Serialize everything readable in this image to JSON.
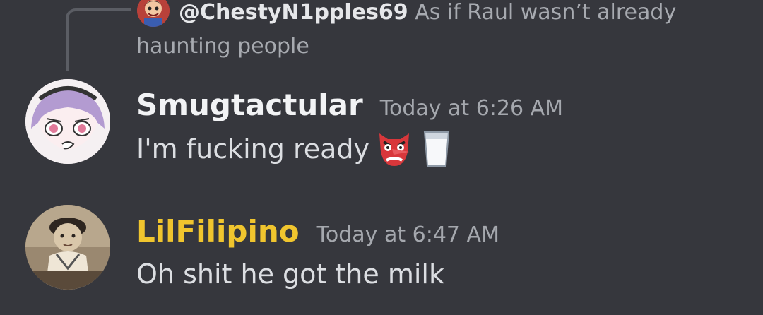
{
  "reply": {
    "username": "@ChestyN1pples69",
    "text": "As if Raul wasn’t already haunting people"
  },
  "messages": [
    {
      "username": "Smugtactular",
      "username_color": "#f2f3f5",
      "timestamp": "Today at 6:26 AM",
      "text": "I'm fucking ready",
      "emojis": [
        "goblin-mask-emoji",
        "glass-of-milk-emoji"
      ]
    },
    {
      "username": "LilFilipino",
      "username_color": "#f0c52e",
      "timestamp": "Today at 6:47 AM",
      "text": "Oh shit he got the milk"
    }
  ]
}
